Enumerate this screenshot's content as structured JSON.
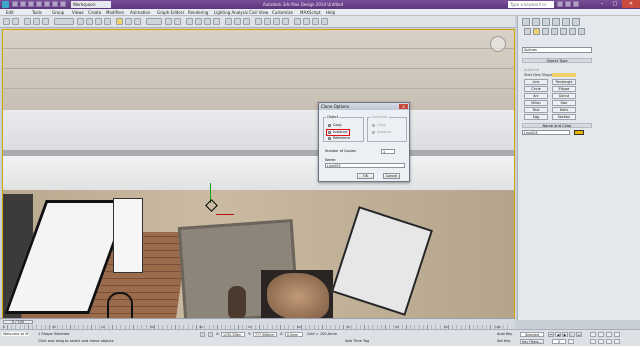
{
  "titlebar": {
    "workspace": "Workspace: Default",
    "title": "Autodesk 3ds Max Design 2014   Untitled",
    "search_placeholder": "Type a keyword or phrase"
  },
  "menubar": [
    "Edit",
    "Tools",
    "Group",
    "Views",
    "Create",
    "Modifiers",
    "Animation",
    "Graph Editors",
    "Rendering",
    "Lighting Analysis",
    "Civil View",
    "Customize",
    "MAXScript",
    "Help"
  ],
  "viewport": {
    "label": "[+] [Top] [Realistic]"
  },
  "dialog": {
    "title": "Clone Options",
    "close": "x",
    "object_group": "Object",
    "object_options": [
      "Copy",
      "Instance",
      "Reference"
    ],
    "selected_object_option": "Instance",
    "controller_group": "Controller",
    "controller_options": [
      "Copy",
      "Instance"
    ],
    "copies_label": "Number of Copies:",
    "copies_value": "1",
    "name_label": "Name:",
    "name_value": "Line003",
    "ok": "OK",
    "cancel": "Cancel"
  },
  "cmdpanel": {
    "object_type_head": "Object Type",
    "autogrid": "AutoGrid",
    "start_new_shape": "Start New Shape",
    "category": "Splines",
    "buttons": [
      "Line",
      "Rectangle",
      "Circle",
      "Ellipse",
      "Arc",
      "Donut",
      "NGon",
      "Star",
      "Text",
      "Helix",
      "Egg",
      "Section"
    ],
    "name_color_head": "Name and Color",
    "name_value": "Line003",
    "color_swatch": "#e6b800"
  },
  "timeline": {
    "slider": "0 / 100",
    "ticks": [
      "0",
      "10",
      "20",
      "30",
      "40",
      "50",
      "60",
      "70",
      "80",
      "90",
      "100"
    ]
  },
  "statusbar": {
    "selection": "1 Shape Selected",
    "prompt": "Click and drag to select and move objects",
    "welcome": "Welcome to M",
    "x_label": "X:",
    "x_value": "1235,326m",
    "y_label": "Y:",
    "y_value": "777,906mm",
    "z_label": "Z:",
    "z_value": "0,0mm",
    "grid": "Grid = 100,0mm",
    "add_time_tag": "Add Time Tag",
    "auto_key": "Auto Key",
    "set_key": "Set Key",
    "selected_dropdown": "Selected",
    "key_filters": "Key Filters...",
    "frame_value": "0"
  }
}
